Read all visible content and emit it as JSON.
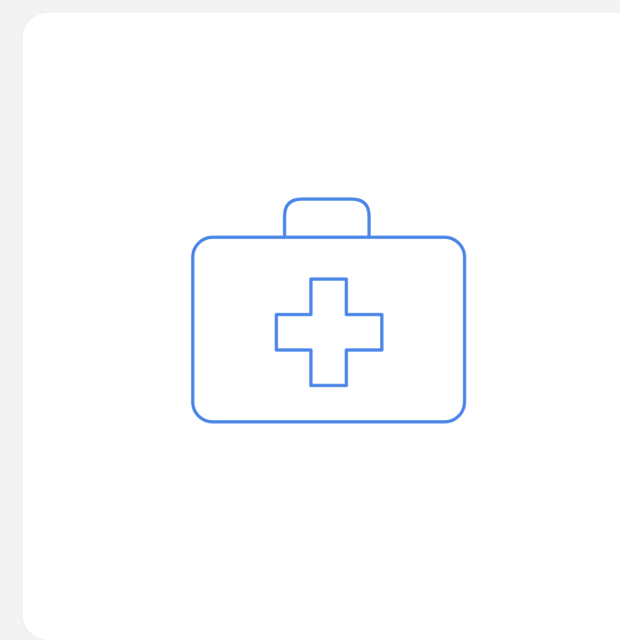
{
  "card": {
    "icon": "first-aid-kit-icon",
    "accent_color": "#4a86e8",
    "background_color": "#ffffff"
  }
}
